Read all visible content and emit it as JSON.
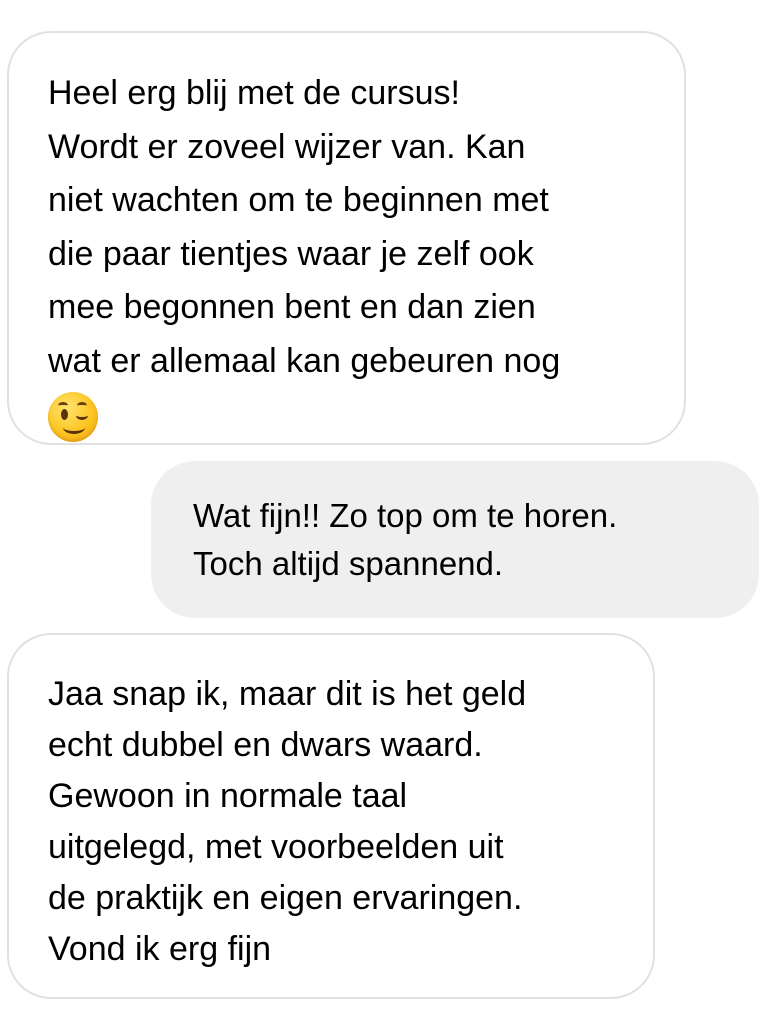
{
  "messages": [
    {
      "direction": "incoming",
      "lines": [
        "Heel erg blij met de cursus!",
        "Wordt er zoveel wijzer van. Kan",
        "niet wachten om te beginnen met",
        "die paar tientjes waar je zelf ook",
        "mee begonnen bent en dan zien",
        "wat er allemaal kan gebeuren nog"
      ],
      "emoji": "winking-face-emoji"
    },
    {
      "direction": "outgoing",
      "lines": [
        "Wat fijn!! Zo top om te horen.",
        "Toch altijd spannend."
      ]
    },
    {
      "direction": "incoming",
      "lines": [
        "Jaa snap ik, maar dit is het geld",
        "echt dubbel en dwars waard.",
        "Gewoon in normale taal",
        "uitgelegd, met voorbeelden uit",
        "de praktijk en eigen ervaringen.",
        "Vond ik erg fijn"
      ]
    }
  ],
  "colors": {
    "incoming_bubble": "#ffffff",
    "incoming_border": "#e1e1e1",
    "outgoing_bubble": "#efefef",
    "text": "#000000"
  }
}
